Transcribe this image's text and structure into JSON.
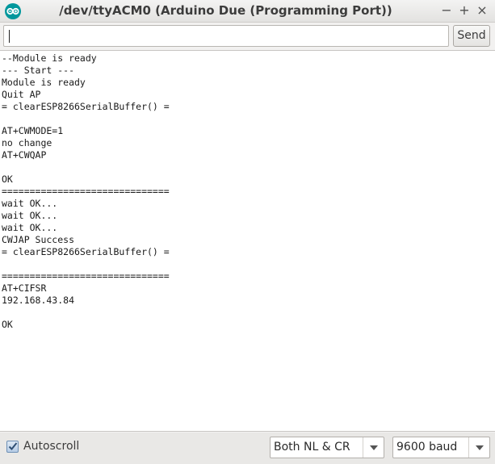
{
  "window": {
    "title": "/dev/ttyACM0 (Arduino Due (Programming Port))",
    "minimize_label": "−",
    "maximize_label": "+",
    "close_label": "×"
  },
  "input": {
    "value": "",
    "send_label": "Send"
  },
  "output": {
    "lines": [
      "--Module is ready",
      "--- Start ---",
      "Module is ready",
      "Quit AP",
      "= clearESP8266SerialBuffer() =",
      "",
      "AT+CWMODE=1",
      "no change",
      "AT+CWQAP",
      "",
      "OK",
      "==============================",
      "wait OK...",
      "wait OK...",
      "wait OK...",
      "CWJAP Success",
      "= clearESP8266SerialBuffer() =",
      "",
      "==============================",
      "AT+CIFSR",
      "192.168.43.84",
      "",
      "OK"
    ]
  },
  "status": {
    "autoscroll_label": "Autoscroll",
    "autoscroll_checked": true,
    "line_ending": "Both NL & CR",
    "baud_rate": "9600 baud"
  },
  "colors": {
    "app_icon": "#00979c",
    "check_border": "#6c8fb5"
  }
}
